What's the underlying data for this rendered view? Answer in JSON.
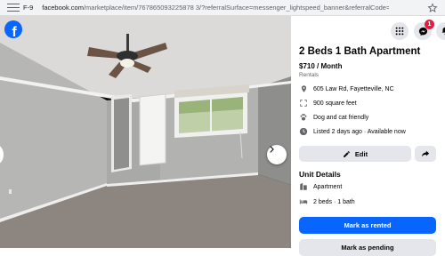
{
  "browser": {
    "site_indicator": "F-9",
    "url_domain": "facebook.com",
    "url_path": "/marketplace/item/767865093225878 3/?referralSurface=messenger_lightspeed_banner&referralCode=messen..."
  },
  "photo": {
    "brand": "f"
  },
  "header": {
    "notification_count": "1"
  },
  "listing": {
    "title": "2 Beds 1 Bath Apartment",
    "price": "$710 / Month",
    "category": "Rentals",
    "details": [
      {
        "icon": "location-pin-icon",
        "text": "605 Law Rd, Fayetteville, NC"
      },
      {
        "icon": "size-icon",
        "text": "900 square feet"
      },
      {
        "icon": "paw-icon",
        "text": "Dog and cat friendly"
      },
      {
        "icon": "clock-icon",
        "text": "Listed 2 days ago · Available now"
      }
    ]
  },
  "actions": {
    "edit_label": "Edit",
    "mark_rented_label": "Mark as rented",
    "mark_pending_label": "Mark as pending"
  },
  "unit_details": {
    "title": "Unit Details",
    "items": [
      {
        "icon": "building-icon",
        "text": "Apartment"
      },
      {
        "icon": "bed-icon",
        "text": "2 beds · 1 bath"
      }
    ]
  },
  "colors": {
    "primary": "#0866ff",
    "secondary_button": "#e4e6eb",
    "badge": "#e41e3f"
  }
}
